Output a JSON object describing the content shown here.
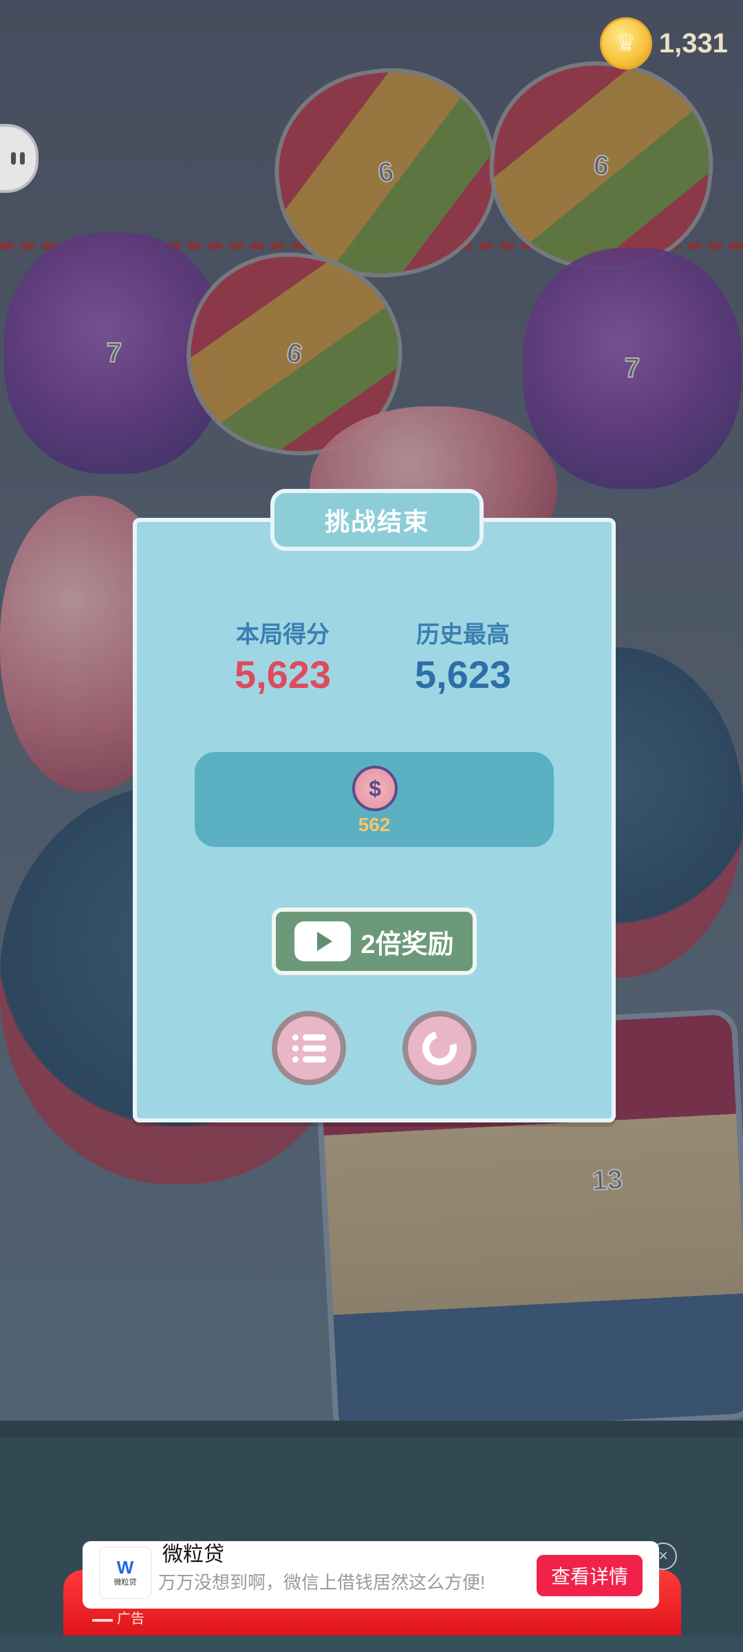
{
  "hud": {
    "coins": "1,331",
    "coin_icon": "crown-coin-icon",
    "pause_icon": "pause-icon"
  },
  "board": {
    "pieces": [
      {
        "kind": "rainbow-candy",
        "number": "6"
      },
      {
        "kind": "rainbow-candy",
        "number": "6"
      },
      {
        "kind": "grape",
        "number": "7"
      },
      {
        "kind": "rainbow-candy",
        "number": "6"
      },
      {
        "kind": "grape",
        "number": "7"
      },
      {
        "kind": "cake",
        "number": "13"
      }
    ]
  },
  "dialog": {
    "title": "挑战结束",
    "current_label": "本局得分",
    "current_score": "5,623",
    "best_label": "历史最高",
    "best_score": "5,623",
    "reward_amount": "562",
    "reward_icon": "dollar-coin-icon",
    "double_label": "2倍奖励",
    "double_icon": "play-video-icon",
    "rank_icon": "list-icon",
    "replay_icon": "replay-icon"
  },
  "ad": {
    "brand_logo_text": "W",
    "brand_logo_sub": "微粒贷",
    "title": "微粒贷",
    "description": "万万没想到啊，微信上借钱居然这么方便!",
    "cta": "查看详情",
    "tag": "广告",
    "close_icon": "close-icon"
  }
}
